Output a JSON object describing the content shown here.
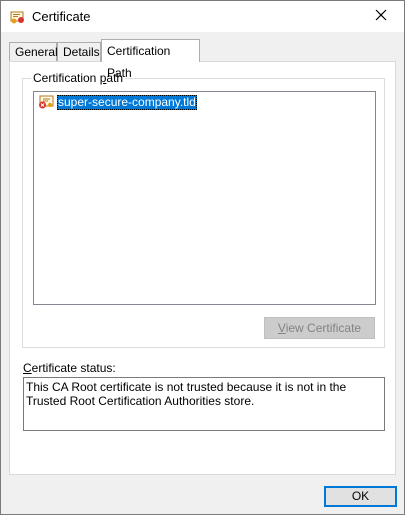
{
  "window": {
    "title": "Certificate",
    "icon": "certificate-icon",
    "close_icon": "close-icon"
  },
  "tabs": [
    {
      "label": "General",
      "active": false
    },
    {
      "label": "Details",
      "active": false
    },
    {
      "label": "Certification Path",
      "active": true
    }
  ],
  "certification_path": {
    "group_label_prefix": "Certification ",
    "group_label_mnemonic": "p",
    "group_label_suffix": "ath",
    "items": [
      {
        "label": "super-secure-company.tld",
        "icon": "certificate-error-icon",
        "selected": true
      }
    ],
    "view_button": {
      "mnemonic": "V",
      "rest": "iew Certificate",
      "enabled": false
    }
  },
  "status": {
    "label_mnemonic": "C",
    "label_rest": "ertificate status:",
    "text": "This CA Root certificate is not trusted because it is not in the Trusted Root Certification Authorities store."
  },
  "footer": {
    "ok_label": "OK"
  },
  "colors": {
    "selection": "#0078d7",
    "focus_border": "#0078d7",
    "disabled_button": "#cccccc"
  }
}
